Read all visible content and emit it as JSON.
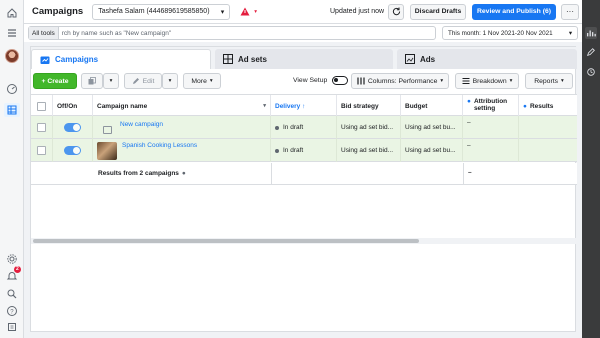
{
  "topbar": {
    "title": "Campaigns",
    "account": "Tashefa Salam (444689619585850)",
    "updated": "Updated just now",
    "discard": "Discard Drafts",
    "publish": "Review and Publish (6)",
    "more": "···"
  },
  "search": {
    "all_tools": "All tools",
    "placeholder": "rch by name such as \"New campaign\"",
    "date_range": "This month: 1 Nov 2021-20 Nov 2021"
  },
  "leftbar": {
    "notification_count": "2"
  },
  "tabs": [
    {
      "label": "Campaigns"
    },
    {
      "label": "Ad sets"
    },
    {
      "label": "Ads"
    }
  ],
  "toolbar": {
    "create": "+ Create",
    "edit": "Edit",
    "more": "More",
    "view_setup": "View Setup",
    "columns": "Columns: Performance",
    "breakdown": "Breakdown",
    "reports": "Reports"
  },
  "table": {
    "headers": {
      "onoff": "Off/On",
      "name": "Campaign name",
      "delivery": "Delivery ↑",
      "bid": "Bid strategy",
      "budget": "Budget",
      "attribution": "Attribution setting",
      "results": "Results"
    },
    "rows": [
      {
        "name": "New campaign",
        "delivery": "In draft",
        "bid": "Using ad set bid...",
        "budget": "Using ad set bu...",
        "attribution": "–"
      },
      {
        "name": "Spanish Cooking Lessons",
        "delivery": "In draft",
        "bid": "Using ad set bid...",
        "budget": "Using ad set bu...",
        "attribution": "–"
      }
    ],
    "results_label": "Results from 2 campaigns",
    "results_attribution": "–"
  },
  "colors": {
    "accent": "#1877f2",
    "create": "#42b72a",
    "row_highlight": "#eaf5e4"
  }
}
